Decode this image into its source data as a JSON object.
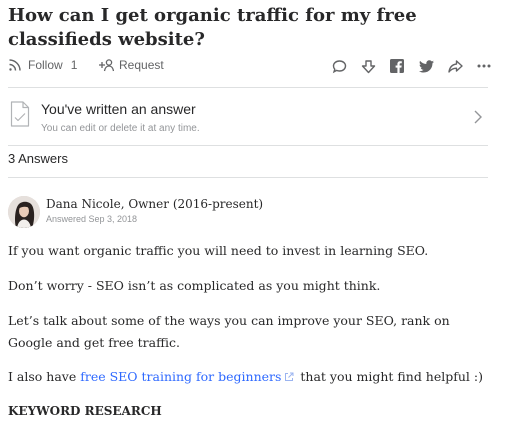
{
  "question": {
    "title": "How can I get organic traffic for my free classifieds website?"
  },
  "actions": {
    "follow_label": "Follow",
    "follow_count": "1",
    "request_label": "Request",
    "icons": [
      "comment-icon",
      "downvote-icon",
      "facebook-icon",
      "twitter-icon",
      "share-icon",
      "more-icon"
    ]
  },
  "answered_notice": {
    "title": "You've written an answer",
    "subtitle": "You can edit or delete it at any time."
  },
  "answers_count": "3 Answers",
  "answer": {
    "author": "Dana Nicole, Owner (2016-present)",
    "date": "Answered Sep 3, 2018",
    "paragraphs": [
      "If you want organic traffic you will need to invest in learning SEO.",
      "Don’t worry - SEO isn’t as complicated as you might think.",
      "Let’s talk about some of the ways you can improve your SEO, rank on Google and get free traffic."
    ],
    "p4_before": "I also have ",
    "p4_link": "free SEO training for beginners",
    "p4_after": " that you might find helpful :)",
    "heading": "KEYWORD RESEARCH"
  }
}
